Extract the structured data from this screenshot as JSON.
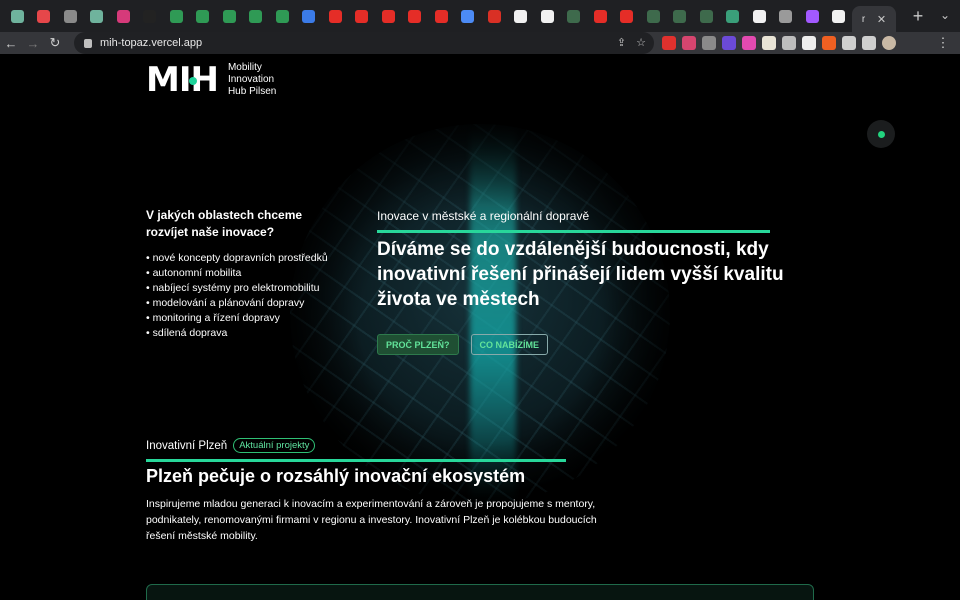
{
  "browser": {
    "tabs": [
      {
        "icon": "chatgpt-icon",
        "color": "#6fb39d"
      },
      {
        "icon": "pocket-icon",
        "color": "#e6474a"
      },
      {
        "icon": "code-icon",
        "color": "#8a8a8a"
      },
      {
        "icon": "chatgpt-icon",
        "color": "#6fb39d"
      },
      {
        "icon": "app-icon",
        "color": "#d63a7a"
      },
      {
        "icon": "github-icon",
        "color": "#222222"
      },
      {
        "icon": "meet-icon",
        "color": "#2f9a55"
      },
      {
        "icon": "meet-icon",
        "color": "#2f9a55"
      },
      {
        "icon": "meet-icon",
        "color": "#2f9a55"
      },
      {
        "icon": "meet-icon",
        "color": "#2f9a55"
      },
      {
        "icon": "meet-icon",
        "color": "#2f9a55"
      },
      {
        "icon": "calendar-icon",
        "color": "#3b7be8"
      },
      {
        "icon": "youtube-icon",
        "color": "#e52d27"
      },
      {
        "icon": "youtube-icon",
        "color": "#e52d27"
      },
      {
        "icon": "youtube-icon",
        "color": "#e52d27"
      },
      {
        "icon": "youtube-icon",
        "color": "#e52d27"
      },
      {
        "icon": "youtube-icon",
        "color": "#e52d27"
      },
      {
        "icon": "docs-icon",
        "color": "#4c8bf5"
      },
      {
        "icon": "gmail-icon",
        "color": "#d93025"
      },
      {
        "icon": "google-icon",
        "color": "#f1f1f1"
      },
      {
        "icon": "google-icon",
        "color": "#f1f1f1"
      },
      {
        "icon": "terminal-icon",
        "color": "#3e6a4c"
      },
      {
        "icon": "youtube-icon",
        "color": "#e52d27"
      },
      {
        "icon": "youtube-icon",
        "color": "#e52d27"
      },
      {
        "icon": "terminal-icon",
        "color": "#3e6a4c"
      },
      {
        "icon": "terminal-icon",
        "color": "#3e6a4c"
      },
      {
        "icon": "terminal-icon",
        "color": "#3e6a4c"
      },
      {
        "icon": "chatgpt-icon",
        "color": "#3a9f7a"
      },
      {
        "icon": "google-icon",
        "color": "#f1f1f1"
      },
      {
        "icon": "globe-icon",
        "color": "#9a9a9a"
      },
      {
        "icon": "figma-icon",
        "color": "#a259ff"
      },
      {
        "icon": "google-icon",
        "color": "#f1f1f1"
      }
    ],
    "active_tab_label": "r",
    "close_glyph": "✕",
    "new_tab_glyph": "+",
    "tab_search_glyph": "⌄",
    "back_glyph": "←",
    "forward_glyph": "→",
    "reload_glyph": "↻",
    "url": "mih-topaz.vercel.app",
    "share_glyph": "⇪",
    "star_glyph": "☆",
    "menu_glyph": "⋮",
    "extensions": [
      {
        "icon": "shield-extension-icon",
        "color": "#e0312e"
      },
      {
        "icon": "pocket-extension-icon",
        "color": "#d6456f"
      },
      {
        "icon": "formula-extension-icon",
        "color": "#8a8a8a"
      },
      {
        "icon": "puzzle-extension-icon",
        "color": "#6b4ad8"
      },
      {
        "icon": "color-extension-icon",
        "color": "#e34ab0"
      },
      {
        "icon": "note-extension-icon",
        "color": "#e9e4d6"
      },
      {
        "icon": "copy-extension-icon",
        "color": "#bdbdbd"
      },
      {
        "icon": "b-extension-icon",
        "color": "#eeeeee"
      },
      {
        "icon": "orange-extension-icon",
        "color": "#f06022"
      },
      {
        "icon": "extensions-puzzle-icon",
        "color": "#cfcfcf"
      },
      {
        "icon": "sidepanel-icon",
        "color": "#cfcfcf"
      },
      {
        "icon": "profile-avatar-icon",
        "color": "#c9b9a5"
      }
    ]
  },
  "logo": {
    "mark": "MIH",
    "line1": "Mobility",
    "line2": "Innovation",
    "line3": "Hub Pilsen"
  },
  "colors": {
    "accent": "#28d79a",
    "status": "#22d37e"
  },
  "left": {
    "title": "V jakých oblastech chceme rozvíjet naše inovace?",
    "items": [
      "• nové koncepty dopravních prostředků",
      "• autonomní mobilita",
      "• nabíjecí systémy pro elektromobilitu",
      "• modelování a plánování dopravy",
      "• monitoring a řízení dopravy",
      "• sdílená doprava"
    ]
  },
  "hero": {
    "kicker": "Inovace v městské a regionální dopravě",
    "title": "Díváme se do vzdálenější budoucnosti, kdy inovativní řešení přinášejí lidem vyšší kvalitu života ve městech",
    "btn_primary": "PROČ PLZEŇ?",
    "btn_secondary": "CO NABÍZÍME"
  },
  "innov": {
    "label": "Inovativní Plzeň",
    "pill": "Aktuální projekty",
    "title": "Plzeň pečuje o rozsáhlý inovační ekosystém",
    "text": "Inspirujeme mladou generaci k inovacím a experimentování a zároveň je propojujeme s mentory, podnikately, renomovanými firmami v regionu a investory. Inovativní Plzeň je kolébkou budoucích řešení městské mobility."
  }
}
